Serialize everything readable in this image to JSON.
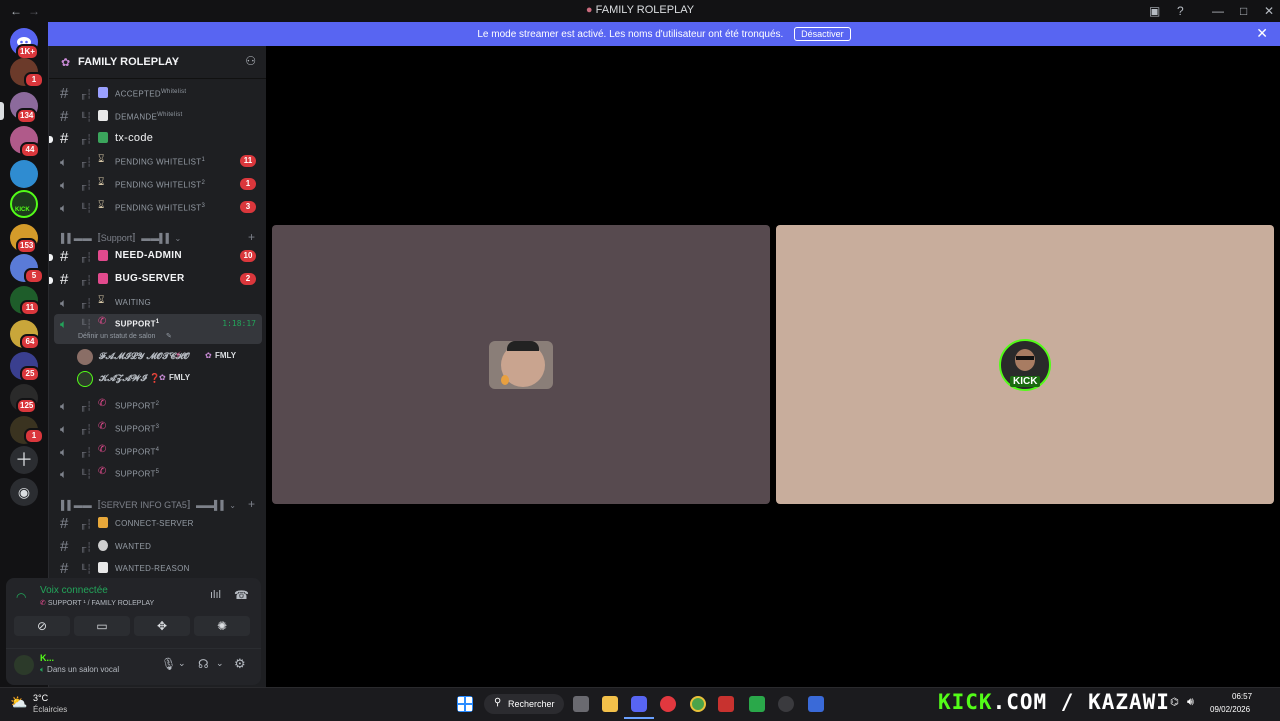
{
  "window": {
    "title": "FAMILY ROLEPLAY"
  },
  "banner": {
    "message": "Le mode streamer est activé. Les noms d'utilisateur ont été tronqués.",
    "button": "Désactiver"
  },
  "rail": {
    "badges": [
      "1K+",
      "1",
      "134",
      "44",
      "153",
      "5",
      "11",
      "64",
      "25",
      "125",
      "1"
    ],
    "kick_label": "KICK"
  },
  "server": {
    "name": "FAMILY ROLEPLAY"
  },
  "channels_top": [
    {
      "label": "ACCEPTED",
      "sup": "Whitelist"
    },
    {
      "label": "DEMANDE",
      "sup": "Whitelist"
    },
    {
      "label": "tx-code"
    },
    {
      "label": "PENDING WHITELIST",
      "sup": "1",
      "badge": "11"
    },
    {
      "label": "PENDING WHITELIST",
      "sup": "2",
      "badge": "1"
    },
    {
      "label": "PENDING WHITELIST",
      "sup": "3",
      "badge": "3"
    }
  ],
  "category_support": "▌▌▬▬〚Support〛▬▬▌▌",
  "channels_support": [
    {
      "label": "NEED-ADMIN",
      "badge": "10"
    },
    {
      "label": "BUG-SERVER",
      "badge": "2"
    },
    {
      "label": "WAITING"
    }
  ],
  "active_voice": {
    "label": "SUPPORT",
    "sup": "1",
    "timer": "1:18:17",
    "status": "Définir un statut de salon"
  },
  "voice_users": [
    {
      "name": "𝓕𝓐𝓜𝓘𝓛𝓨 𝓜𝓞𝓣𝓒𝓗𝓞",
      "tag": "FMLY"
    },
    {
      "name": "𝓚𝓐𝓩𝓐𝓦𝓘 ❓",
      "tag": "FMLY"
    }
  ],
  "channels_support_more": [
    {
      "label": "SUPPORT",
      "sup": "2"
    },
    {
      "label": "SUPPORT",
      "sup": "3"
    },
    {
      "label": "SUPPORT",
      "sup": "4"
    },
    {
      "label": "SUPPORT",
      "sup": "5"
    }
  ],
  "category_info": "▌▌▬▬〚SERVER INFO GTA5〛▬▬▌▌",
  "channels_info": [
    {
      "label": "CONNECT-SERVER"
    },
    {
      "label": "WANTED"
    },
    {
      "label": "WANTED-REASON"
    }
  ],
  "voice_panel": {
    "title": "Voix connectée",
    "channel": "SUPPORT ¹ / FAMILY ROLEPLAY",
    "user_short": "K...",
    "user_status": "Dans un salon vocal"
  },
  "stream": {
    "kick_label": "KICK"
  },
  "taskbar": {
    "weather_temp": "3°C",
    "weather_desc": "Éclaircies",
    "search": "Rechercher",
    "watermark_kick": "KICK",
    "watermark_rest": ".COM / KAZAWI",
    "time": "06:57",
    "date": "09/02/2026"
  },
  "colors": {
    "accent": "#5865f2",
    "badge": "#da373c",
    "voice_green": "#23a55a",
    "kick_green": "#53fc18",
    "tile_left": "#574a4f",
    "tile_right": "#c8ad9c"
  }
}
